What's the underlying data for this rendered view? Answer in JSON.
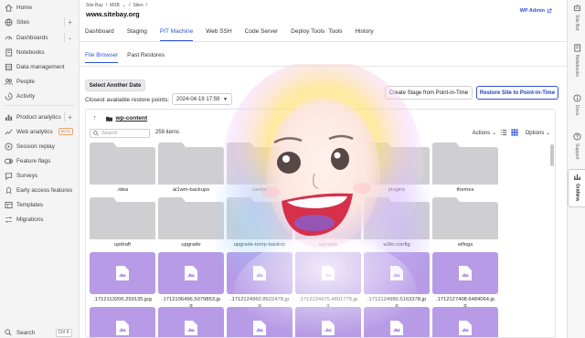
{
  "sidebar": {
    "items": [
      {
        "label": "Home",
        "icon": "home-icon"
      },
      {
        "label": "Sites",
        "icon": "globe-icon",
        "has_plus": true
      },
      {
        "label": "Dashboards",
        "icon": "dashboard-icon",
        "has_plus": true
      },
      {
        "label": "Notebooks",
        "icon": "notebook-icon"
      },
      {
        "label": "Data management",
        "icon": "database-icon"
      },
      {
        "label": "People",
        "icon": "people-icon"
      },
      {
        "label": "Activity",
        "icon": "activity-icon"
      },
      {
        "label": "Product analytics",
        "icon": "bar-chart-icon",
        "has_plus": true
      },
      {
        "label": "Web analytics",
        "icon": "web-analytics-icon",
        "badge": "BETA"
      },
      {
        "label": "Session replay",
        "icon": "replay-icon"
      },
      {
        "label": "Feature flags",
        "icon": "toggle-icon"
      },
      {
        "label": "Surveys",
        "icon": "survey-icon"
      },
      {
        "label": "Early access features",
        "icon": "rocket-icon"
      },
      {
        "label": "Templates",
        "icon": "template-icon"
      },
      {
        "label": "Migrations",
        "icon": "migration-icon"
      }
    ],
    "search": {
      "label": "Search",
      "shortcut": "Ctrl K"
    }
  },
  "right_rail": {
    "items": [
      {
        "label": "Site Bot",
        "icon": "bot-icon"
      },
      {
        "label": "Notebooks",
        "icon": "notebook-icon"
      },
      {
        "label": "Docs",
        "icon": "info-icon"
      },
      {
        "label": "Support",
        "icon": "help-icon"
      },
      {
        "label": "Grafana",
        "icon": "grafana-icon",
        "active": true
      }
    ]
  },
  "header": {
    "breadcrumbs": [
      "Site Bay",
      "MSB",
      "Sites"
    ],
    "site_title": "www.sitebay.org",
    "wp_admin": "WP Admin"
  },
  "tabs": [
    {
      "label": "Dashboard"
    },
    {
      "label": "Staging"
    },
    {
      "label": "PIT Machine",
      "active": true
    },
    {
      "label": "Web SSH"
    },
    {
      "label": "Code Server"
    },
    {
      "label": "Deploy Tools"
    },
    {
      "label": "Tools"
    },
    {
      "label": "History"
    }
  ],
  "subtabs": [
    {
      "label": "File Browser",
      "active": true
    },
    {
      "label": "Past Restores"
    }
  ],
  "controls": {
    "select_date_button": "Select Another Date",
    "restore_points_label": "Closest available restore points:",
    "restore_point_value": "2024-04-19 17:59",
    "create_stage_button": "Create Stage from Point-in-Time",
    "restore_site_button": "Restore Site to Point-in-Time"
  },
  "file_browser": {
    "path": "wp-content",
    "search_placeholder": "Search",
    "items_count": "259 items",
    "actions_label": "Actions",
    "options_label": "Options",
    "folders": [
      {
        "name": ".idea"
      },
      {
        "name": "ai1wm-backups"
      },
      {
        "name": "cache"
      },
      {
        "name": "languages"
      },
      {
        "name": "plugins"
      },
      {
        "name": "themes"
      },
      {
        "name": "updraft"
      },
      {
        "name": "upgrade"
      },
      {
        "name": "upgrade-temp-backup"
      },
      {
        "name": "uploads"
      },
      {
        "name": "w3tc-config"
      },
      {
        "name": "wflogs"
      }
    ],
    "images": [
      {
        "name": ".1712113206.259135.jpg",
        "name2": ""
      },
      {
        "name": ".1712106496.5079853.jp",
        "name2": "g"
      },
      {
        "name": ".1712124960.8622478.jp",
        "name2": "g"
      },
      {
        "name": ".1712124975.4801775.jp",
        "name2": "g"
      },
      {
        "name": ".1712124980.5163378.jp",
        "name2": "g"
      },
      {
        "name": ".1712127408.6484064.jp",
        "name2": "g"
      }
    ]
  },
  "colors": {
    "accent": "#2f52d6",
    "folder": "#cfcfd1",
    "image_tile": "#b79be6"
  }
}
